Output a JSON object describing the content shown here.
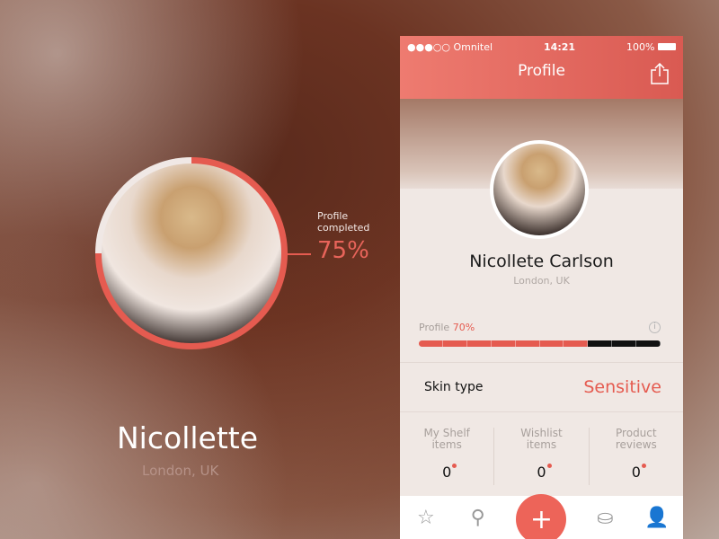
{
  "left_panel": {
    "profile_label": "Profile completed",
    "profile_percent": "75%",
    "name": "Nicollette",
    "location": "London, UK"
  },
  "status_bar": {
    "carrier": "●●●○○ Omnitel",
    "time": "14:21",
    "battery": "100%"
  },
  "header": {
    "title": "Profile",
    "share_icon": "share-icon"
  },
  "profile": {
    "name": "Nicollete Carlson",
    "location": "London, UK"
  },
  "progress": {
    "label": "Profile",
    "percent_text": "70%",
    "fraction": 0.7,
    "segments": 10,
    "info_icon": "i"
  },
  "skin": {
    "label": "Skin type",
    "value": "Sensitive"
  },
  "stats": [
    {
      "label": "My Shelf items",
      "value": "0"
    },
    {
      "label": "Wishlist items",
      "value": "0"
    },
    {
      "label": "Product reviews",
      "value": "0"
    }
  ],
  "tabs": {
    "star": "☆",
    "search": "⚲",
    "plus": "+",
    "jar": "⛀",
    "user": "👤"
  },
  "colors": {
    "accent": "#e55b50",
    "dark": "#111111"
  }
}
